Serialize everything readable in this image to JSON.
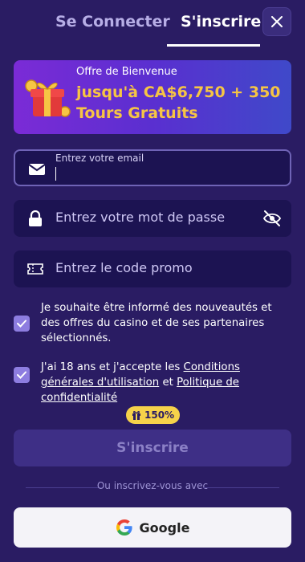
{
  "tabs": {
    "login": "Se Connecter",
    "signup": "S'inscrire",
    "active": "signup"
  },
  "banner": {
    "title": "Offre de Bienvenue",
    "amount": "jusqu'à CA$6,750 + 350 Tours Gratuits"
  },
  "form": {
    "email_placeholder": "Entrez votre email",
    "password_placeholder": "Entrez votre mot de passe",
    "promo_placeholder": "Entrez le code promo"
  },
  "consents": {
    "newsletter": {
      "checked": true,
      "text": "Je souhaite être informé des nouveautés et des offres du casino et de ses partenaires sélectionnés."
    },
    "terms": {
      "checked": true,
      "prefix": "J'ai 18 ans et j'accepte les ",
      "link1": "Conditions générales d'utilisation",
      "middle": " et ",
      "link2": "Politique de confidentialité"
    }
  },
  "badge": "150%",
  "submit_label": "S'inscrire",
  "divider_text": "Ou inscrivez-vous avec",
  "google_label": "Google",
  "icons": [
    "close-icon",
    "gift-icon",
    "mail-icon",
    "lock-icon",
    "eye-off-icon",
    "ticket-icon",
    "check-icon",
    "google-icon"
  ],
  "colors": {
    "background": "#2a1c63",
    "accent": "#f6c544",
    "field": "#1c1352",
    "checkbox": "#8d7de0"
  }
}
